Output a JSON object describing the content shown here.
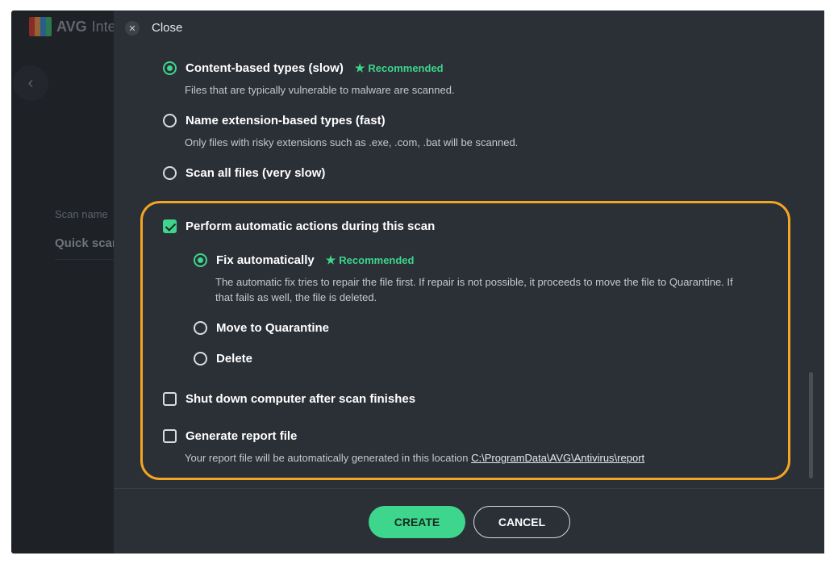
{
  "background": {
    "brand": "AVG",
    "app_name_partial": "Inte",
    "back_icon": "chevron-left-icon",
    "scan_name_label": "Scan name",
    "scan_name_value": "Quick scar"
  },
  "header": {
    "close_icon": "close-icon",
    "close_label": "Close"
  },
  "file_types": [
    {
      "label": "Content-based types (slow)",
      "selected": true,
      "badge": "Recommended",
      "description": "Files that are typically vulnerable to malware are scanned."
    },
    {
      "label": "Name extension-based types (fast)",
      "selected": false,
      "description": "Only files with risky extensions such as .exe, .com, .bat will be scanned."
    },
    {
      "label": "Scan all files (very slow)",
      "selected": false
    }
  ],
  "auto_actions": {
    "label": "Perform automatic actions during this scan",
    "checked": true,
    "options": [
      {
        "label": "Fix automatically",
        "selected": true,
        "badge": "Recommended",
        "description_line1": "The automatic fix tries to repair the file first. If repair is not possible, it proceeds to move the file to Quarantine. If",
        "description_line2": "that fails as well, the file is deleted."
      },
      {
        "label": "Move to Quarantine",
        "selected": false
      },
      {
        "label": "Delete",
        "selected": false
      }
    ]
  },
  "shutdown": {
    "label": "Shut down computer after scan finishes",
    "checked": false
  },
  "report": {
    "label": "Generate report file",
    "checked": false,
    "description": "Your report file will be automatically generated in this location",
    "path": "C:\\ProgramData\\AVG\\Antivirus\\report"
  },
  "footer": {
    "create_label": "CREATE",
    "cancel_label": "CANCEL"
  },
  "colors": {
    "accent": "#3dd68c",
    "highlight": "#f4a524",
    "panel": "#2b2f36"
  }
}
